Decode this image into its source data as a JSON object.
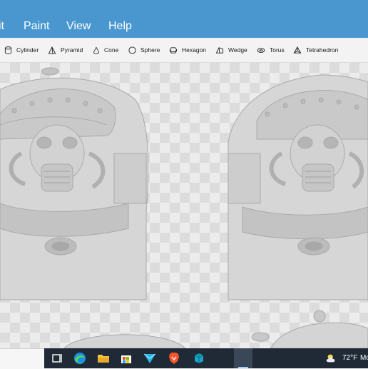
{
  "menu": {
    "items": [
      "it",
      "Paint",
      "View",
      "Help"
    ]
  },
  "toolbar": {
    "shapes": [
      {
        "label": "Cylinder",
        "icon": "cylinder-icon"
      },
      {
        "label": "Pyramid",
        "icon": "pyramid-icon"
      },
      {
        "label": "Cone",
        "icon": "cone-icon"
      },
      {
        "label": "Sphere",
        "icon": "sphere-icon"
      },
      {
        "label": "Hexagon",
        "icon": "hexagon-icon"
      },
      {
        "label": "Wedge",
        "icon": "wedge-icon"
      },
      {
        "label": "Torus",
        "icon": "torus-icon"
      },
      {
        "label": "Tetrahedron",
        "icon": "tetrahedron-icon"
      }
    ]
  },
  "taskbar": {
    "icons": [
      "task-view-icon",
      "edge-browser-icon",
      "file-explorer-icon",
      "microsoft-store-icon",
      "send-arrow-app-icon",
      "brave-browser-icon",
      "3d-builder-app-icon"
    ],
    "weather_temp": "72°F",
    "news_text": "Mo"
  },
  "colors": {
    "menubar": "#4a97d0",
    "toolbar": "#f3f3f3",
    "taskbar": "#1f2a36",
    "model": "#d0d0d0"
  }
}
